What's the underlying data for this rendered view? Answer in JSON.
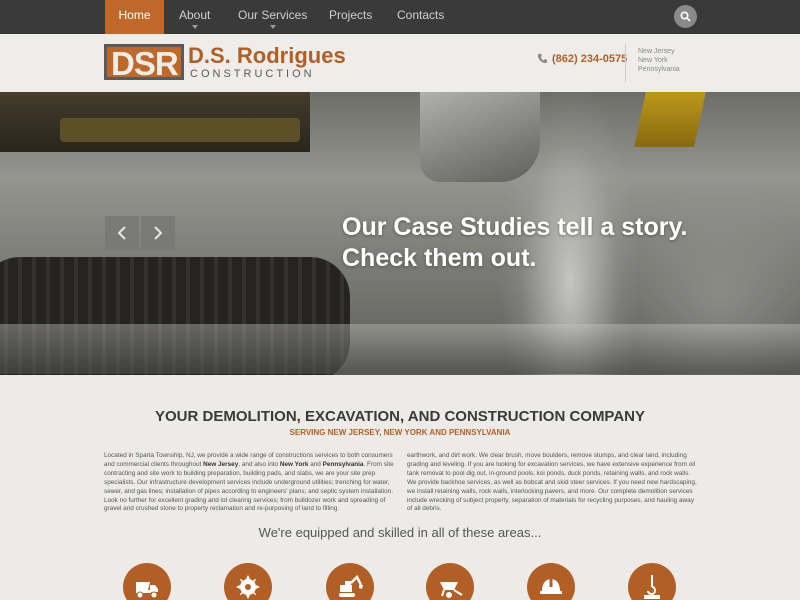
{
  "nav": {
    "items": [
      {
        "label": "Home",
        "active": true,
        "has_dropdown": false
      },
      {
        "label": "About",
        "active": false,
        "has_dropdown": true
      },
      {
        "label": "Our Services",
        "active": false,
        "has_dropdown": true
      },
      {
        "label": "Projects",
        "active": false,
        "has_dropdown": false
      },
      {
        "label": "Contacts",
        "active": false,
        "has_dropdown": false
      }
    ],
    "search_icon": "search-icon"
  },
  "header": {
    "logo_mark": "DSR",
    "logo_name": "D.S. Rodrigues",
    "logo_sub": "CONSTRUCTION",
    "phone": "(862) 234-0575",
    "phone_icon": "phone-icon",
    "states": [
      "New Jersey",
      "New York",
      "Pennsylvania"
    ]
  },
  "hero": {
    "caption_line1": "Our Case Studies tell a story.",
    "caption_line2": "Check them out."
  },
  "content": {
    "heading": "YOUR DEMOLITION, EXCAVATION, AND CONSTRUCTION COMPANY",
    "subheading": "SERVING NEW JERSEY, NEW YORK AND PENNSYLVANIA",
    "col1": {
      "p1": "Located in Sparta Township, NJ, we provide a wide range of constructions services to both consumers and commercial clients throughout ",
      "b1": "New Jersey",
      "p2": ", and also into ",
      "b2": "New York",
      "p3": " and ",
      "b3": "Pennsylvania",
      "p4": ". From site contracting and site work to building preparation, building pads, and slabs, we are your site prep specialists. Our infrastructure development services include underground utilities; trenching for water, sewer, and gas lines; installation of pipes according to engineers' plans; and septic system installation. Look no further for excellent grading and lot clearing services; from bulldozer work and spreading of gravel and crushed stone to property reclamation and re-purposing of land to filling."
    },
    "col2": "earthwork, and dirt work. We clear brush, move boulders, remove stumps, and clear land, including grading and leveling. If you are looking for excavation services, we have extensive experience from oil tank removal to pool dig out, in-ground pools, koi ponds, duck ponds, retaining walls, and rock walls. We provide backhoe services, as well as bobcat and skid steer services. If you need new hardscaping, we install retaining walls, rock walls, interlocking pavers, and more. Our complete demolition services include wrecking of subject property, separation of materials for recycling purposes, and hauling away of all debris.",
    "equipped": "We're equipped and skilled in all of these areas...",
    "service_icons": [
      "dump-truck-icon",
      "saw-blade-icon",
      "excavator-icon",
      "wheelbarrow-icon",
      "hard-hat-icon",
      "crane-hook-icon"
    ]
  },
  "colors": {
    "accent": "#c0682a",
    "brand_text": "#b25f26",
    "nav_bg": "#3a3a3a",
    "page_bg": "#ecebe7"
  }
}
